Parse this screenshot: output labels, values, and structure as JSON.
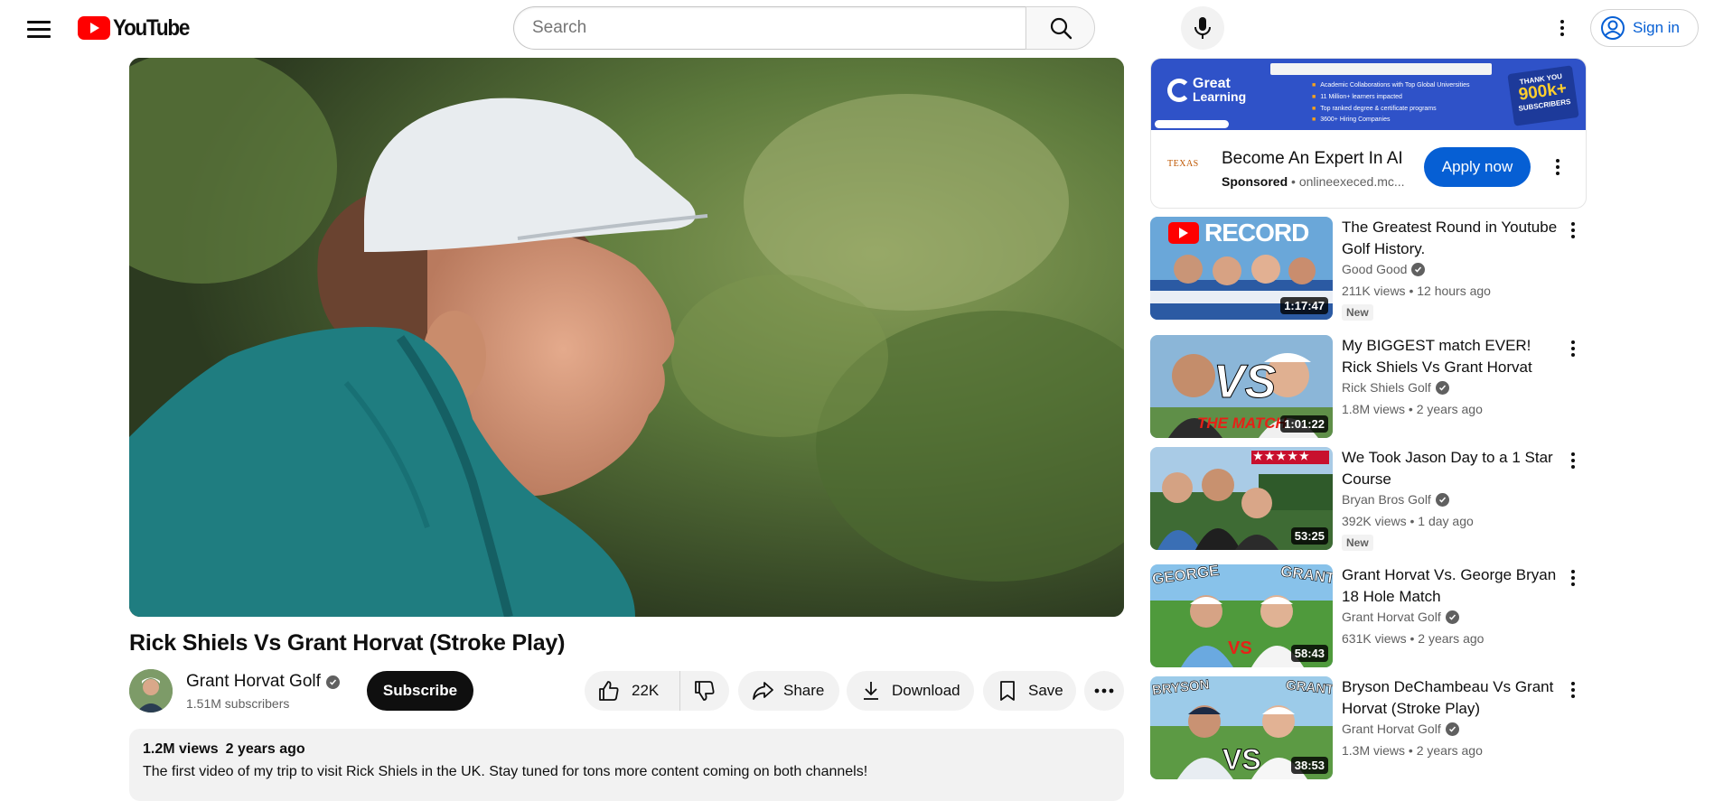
{
  "masthead": {
    "logo_text": "YouTube",
    "search_placeholder": "Search",
    "sign_in": "Sign in"
  },
  "video": {
    "title": "Rick Shiels Vs Grant Horvat (Stroke Play)",
    "channel": "Grant Horvat Golf",
    "subscribers": "1.51M subscribers",
    "subscribe_label": "Subscribe",
    "like_count": "22K",
    "share_label": "Share",
    "download_label": "Download",
    "save_label": "Save",
    "views": "1.2M views",
    "age": "2 years ago",
    "description": "The first video of my trip to visit Rick Shiels in the UK. Stay tuned for tons more content coming on both channels!"
  },
  "ad": {
    "banner_brand": "Great",
    "banner_brand_2": "Learning",
    "banner_points": [
      "Academic Collaborations with Top Global Universities",
      "11 Million+ learners impacted",
      "Top ranked degree & certificate programs",
      "3600+ Hiring Companies"
    ],
    "banner_badge_top": "THANK YOU",
    "banner_badge_number": "900k+",
    "banner_badge_bottom": "SUBSCRIBERS",
    "advertiser_logo": "TEXAS",
    "title": "Become An Expert In AI",
    "sponsored": "Sponsored",
    "domain": "onlineexeced.mc...",
    "cta": "Apply now"
  },
  "related": [
    {
      "title": "The Greatest Round in Youtube Golf History.",
      "channel": "Good Good",
      "meta": "211K views • 12 hours ago",
      "badge": "New",
      "duration": "1:17:47",
      "thumb_text": "RECORD"
    },
    {
      "title": "My BIGGEST match EVER! Rick Shiels Vs Grant Horvat",
      "channel": "Rick Shiels Golf",
      "meta": "1.8M views • 2 years ago",
      "badge": "",
      "duration": "1:01:22",
      "thumb_text": "VS",
      "thumb_text_2": "THE MATCH"
    },
    {
      "title": "We Took Jason Day to a 1 Star Course",
      "channel": "Bryan Bros Golf",
      "meta": "392K views • 1 day ago",
      "badge": "New",
      "duration": "53:25",
      "thumb_text": "★★★★★"
    },
    {
      "title": "Grant Horvat Vs. George Bryan 18 Hole Match",
      "channel": "Grant Horvat Golf",
      "meta": "631K views • 2 years ago",
      "badge": "",
      "duration": "58:43",
      "thumb_text": "GEORGE",
      "thumb_text_2": "GRANT",
      "thumb_text_3": "VS"
    },
    {
      "title": "Bryson DeChambeau Vs Grant Horvat (Stroke Play)",
      "channel": "Grant Horvat Golf",
      "meta": "1.3M views • 2 years ago",
      "badge": "",
      "duration": "38:53",
      "thumb_text": "BRYSON",
      "thumb_text_2": "GRANT",
      "thumb_text_3": "VS"
    }
  ],
  "colors": {
    "brand_red": "#ff0000",
    "link_blue": "#065fd4",
    "text_primary": "#0f0f0f",
    "text_secondary": "#606060",
    "chip_bg": "#f2f2f2"
  },
  "icons": [
    "menu-icon",
    "youtube-logo-icon",
    "search-icon",
    "mic-icon",
    "more-vert-icon",
    "account-icon",
    "thumb-up-icon",
    "thumb-down-icon",
    "share-icon",
    "download-icon",
    "bookmark-icon",
    "more-horiz-icon",
    "verified-icon"
  ]
}
